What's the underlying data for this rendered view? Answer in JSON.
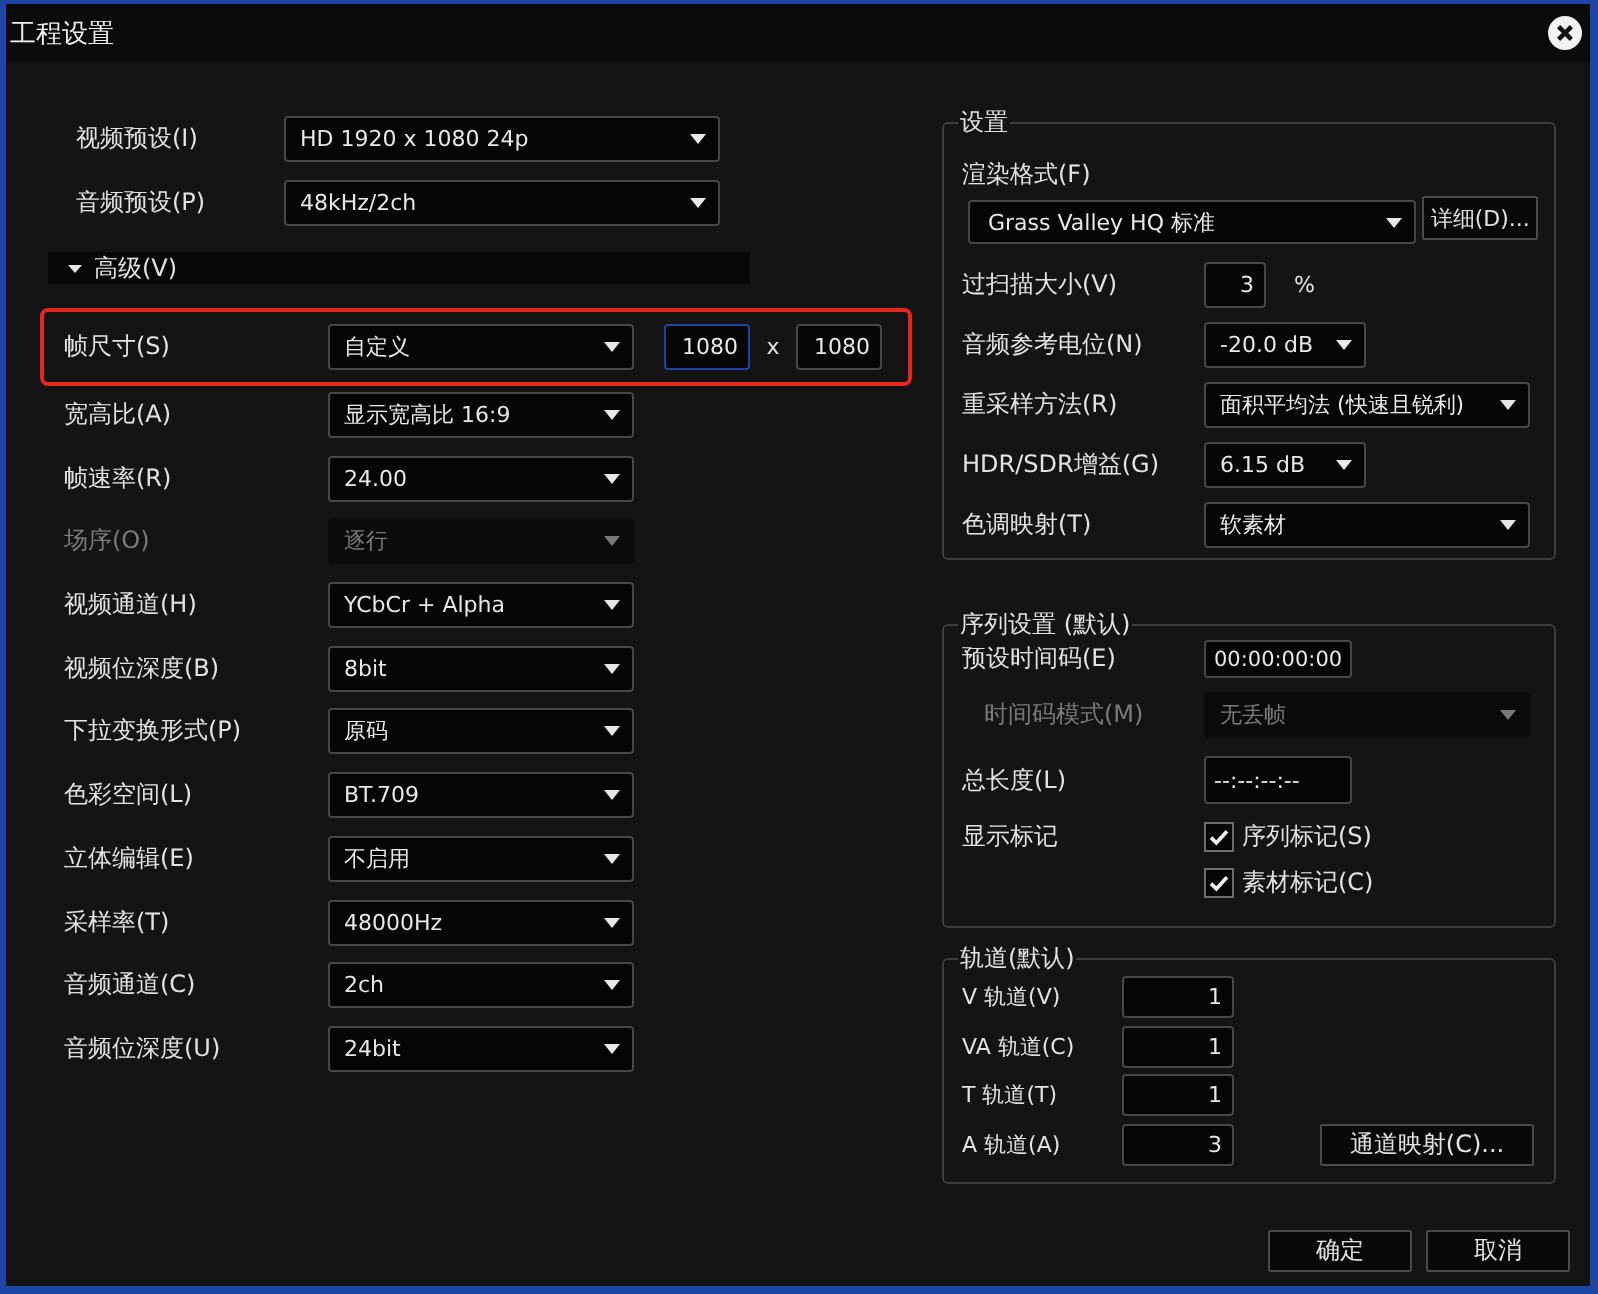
{
  "window": {
    "title": "工程设置"
  },
  "presets": [
    {
      "label": "视频预设(I)",
      "value": "HD 1920 x 1080 24p"
    },
    {
      "label": "音频预设(P)",
      "value": "48kHz/2ch"
    }
  ],
  "advanced": {
    "label": "高级(V)",
    "expanded": true,
    "frame_size": {
      "label": "帧尺寸(S)",
      "value": "自定义",
      "highlighted": true,
      "fields": [
        {
          "value": "1080",
          "focused": true
        },
        {
          "value": "1080",
          "focused": false
        }
      ],
      "separator": "x"
    },
    "rows": [
      {
        "label": "宽高比(A)",
        "value": "显示宽高比 16:9",
        "disabled": false
      },
      {
        "label": "帧速率(R)",
        "value": "24.00",
        "disabled": false
      },
      {
        "label": "场序(O)",
        "value": "逐行",
        "disabled": true
      },
      {
        "label": "视频通道(H)",
        "value": "YCbCr + Alpha",
        "disabled": false
      },
      {
        "label": "视频位深度(B)",
        "value": "8bit",
        "disabled": false
      },
      {
        "label": "下拉变换形式(P)",
        "value": "原码",
        "disabled": false
      },
      {
        "label": "色彩空间(L)",
        "value": "BT.709",
        "disabled": false
      },
      {
        "label": "立体编辑(E)",
        "value": "不启用",
        "disabled": false
      },
      {
        "label": "采样率(T)",
        "value": "48000Hz",
        "disabled": false
      },
      {
        "label": "音频通道(C)",
        "value": "2ch",
        "disabled": false
      },
      {
        "label": "音频位深度(U)",
        "value": "24bit",
        "disabled": false
      }
    ]
  },
  "settings": {
    "title": "设置",
    "render_format": {
      "label": "渲染格式(F)",
      "value": "Grass Valley HQ 标准",
      "button": "详细(D)..."
    },
    "rows": [
      {
        "kind": "number",
        "label": "过扫描大小(V)",
        "value": "3",
        "unit": "%"
      },
      {
        "kind": "compact",
        "label": "音频参考电位(N)",
        "value": "-20.0 dB"
      },
      {
        "kind": "dropdown",
        "label": "重采样方法(R)",
        "value": "面积平均法 (快速且锐利)"
      },
      {
        "kind": "compact",
        "label": "HDR/SDR增益(G)",
        "value": "6.15 dB"
      },
      {
        "kind": "dropdown",
        "label": "色调映射(T)",
        "value": "软素材"
      }
    ]
  },
  "sequence": {
    "title": "序列设置 (默认)",
    "start_timecode": {
      "label": "预设时间码(E)",
      "value": "00:00:00:00"
    },
    "timecode_mode": {
      "label": "时间码模式(M)",
      "value": "无丢帧",
      "disabled": true
    },
    "duration": {
      "label": "总长度(L)",
      "value": "--:--:--:--"
    },
    "markers": {
      "label": "显示标记",
      "options": [
        {
          "label": "序列标记(S)",
          "checked": true
        },
        {
          "label": "素材标记(C)",
          "checked": true
        }
      ]
    }
  },
  "tracks": {
    "title": "轨道(默认)",
    "rows": [
      {
        "label": "V 轨道(V)",
        "value": "1"
      },
      {
        "label": "VA 轨道(C)",
        "value": "1"
      },
      {
        "label": "T 轨道(T)",
        "value": "1"
      },
      {
        "label": "A 轨道(A)",
        "value": "3"
      }
    ],
    "button": "通道映射(C)..."
  },
  "buttons": [
    {
      "label": "确定"
    },
    {
      "label": "取消"
    }
  ]
}
